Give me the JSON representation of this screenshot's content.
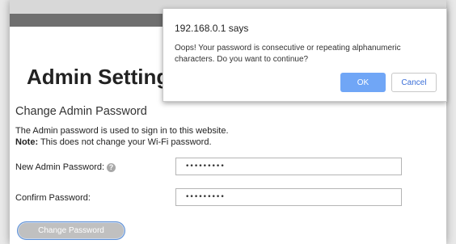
{
  "page": {
    "title": "Admin Settings",
    "section_title": "Change Admin Password",
    "description": "The Admin password is used to sign in to this website.",
    "note_label": "Note:",
    "note_text": " This does not change your Wi-Fi password."
  },
  "form": {
    "new_password_label": "New Admin Password:",
    "help_icon": "?",
    "new_password_value": "•••••••••",
    "confirm_password_label": "Confirm Password:",
    "confirm_password_value": "•••••••••",
    "change_button": "Change Password"
  },
  "dialog": {
    "title": "192.168.0.1 says",
    "message": "Oops! Your password is consecutive or repeating alphanumeric characters. Do you want to continue?",
    "ok": "OK",
    "cancel": "Cancel"
  },
  "colors": {
    "ok_button": "#70a6f6",
    "topbar_dark": "#6f6f6f",
    "change_button_border": "#5c8fd6"
  }
}
